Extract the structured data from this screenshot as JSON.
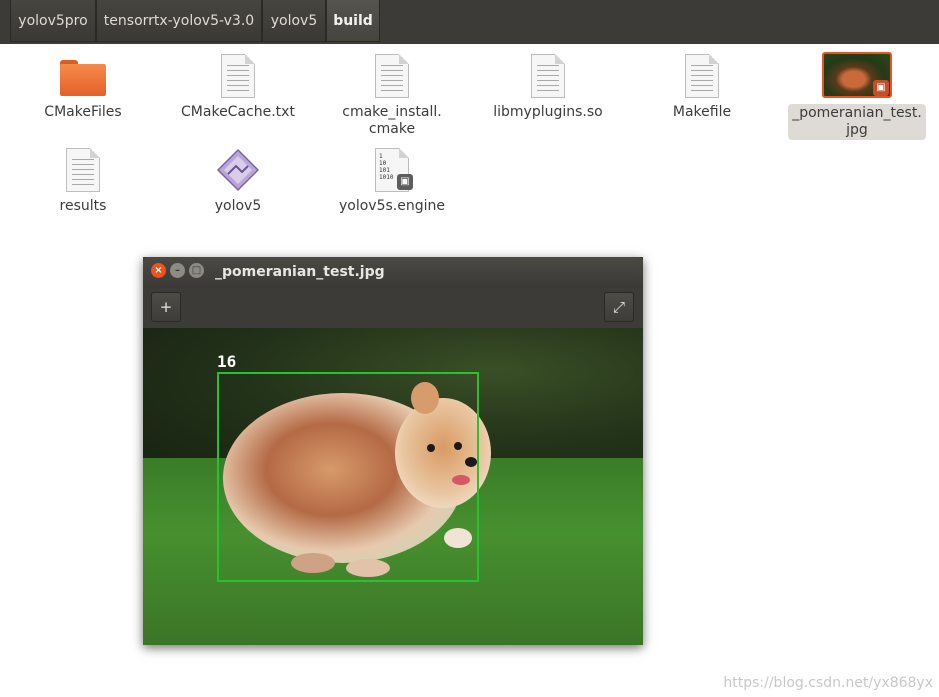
{
  "pathbar": {
    "crumbs": [
      "yolov5pro",
      "tensorrtx-yolov5-v3.0",
      "yolov5",
      "build"
    ]
  },
  "files": [
    {
      "name": "CMakeFiles",
      "icon": "folder-icon"
    },
    {
      "name": "CMakeCache.txt",
      "icon": "text-file-icon"
    },
    {
      "name": "cmake_install.\ncmake",
      "icon": "text-file-icon"
    },
    {
      "name": "libmyplugins.so",
      "icon": "text-file-icon"
    },
    {
      "name": "Makefile",
      "icon": "text-file-icon"
    },
    {
      "name": "_pomeranian_test.\njpg",
      "icon": "image-thumbnail-icon",
      "selected": true
    },
    {
      "name": "results",
      "icon": "text-file-icon"
    },
    {
      "name": "yolov5",
      "icon": "executable-icon"
    },
    {
      "name": "yolov5s.engine",
      "icon": "binary-file-icon",
      "binary_glyph": "1\n10\n101\n1010"
    }
  ],
  "viewer": {
    "title": "_pomeranian_test.jpg",
    "detection_label": "16",
    "box_color": "#27c22e",
    "close_glyph": "×",
    "minimize_glyph": "–",
    "maximize_glyph": "□",
    "add_glyph": "+",
    "fullscreen_glyph": "⤢"
  },
  "watermark": "https://blog.csdn.net/yx868yx",
  "colors": {
    "accent": "#e95420",
    "pathbar_bg": "#3c3b37",
    "close_button": "#e95420"
  }
}
